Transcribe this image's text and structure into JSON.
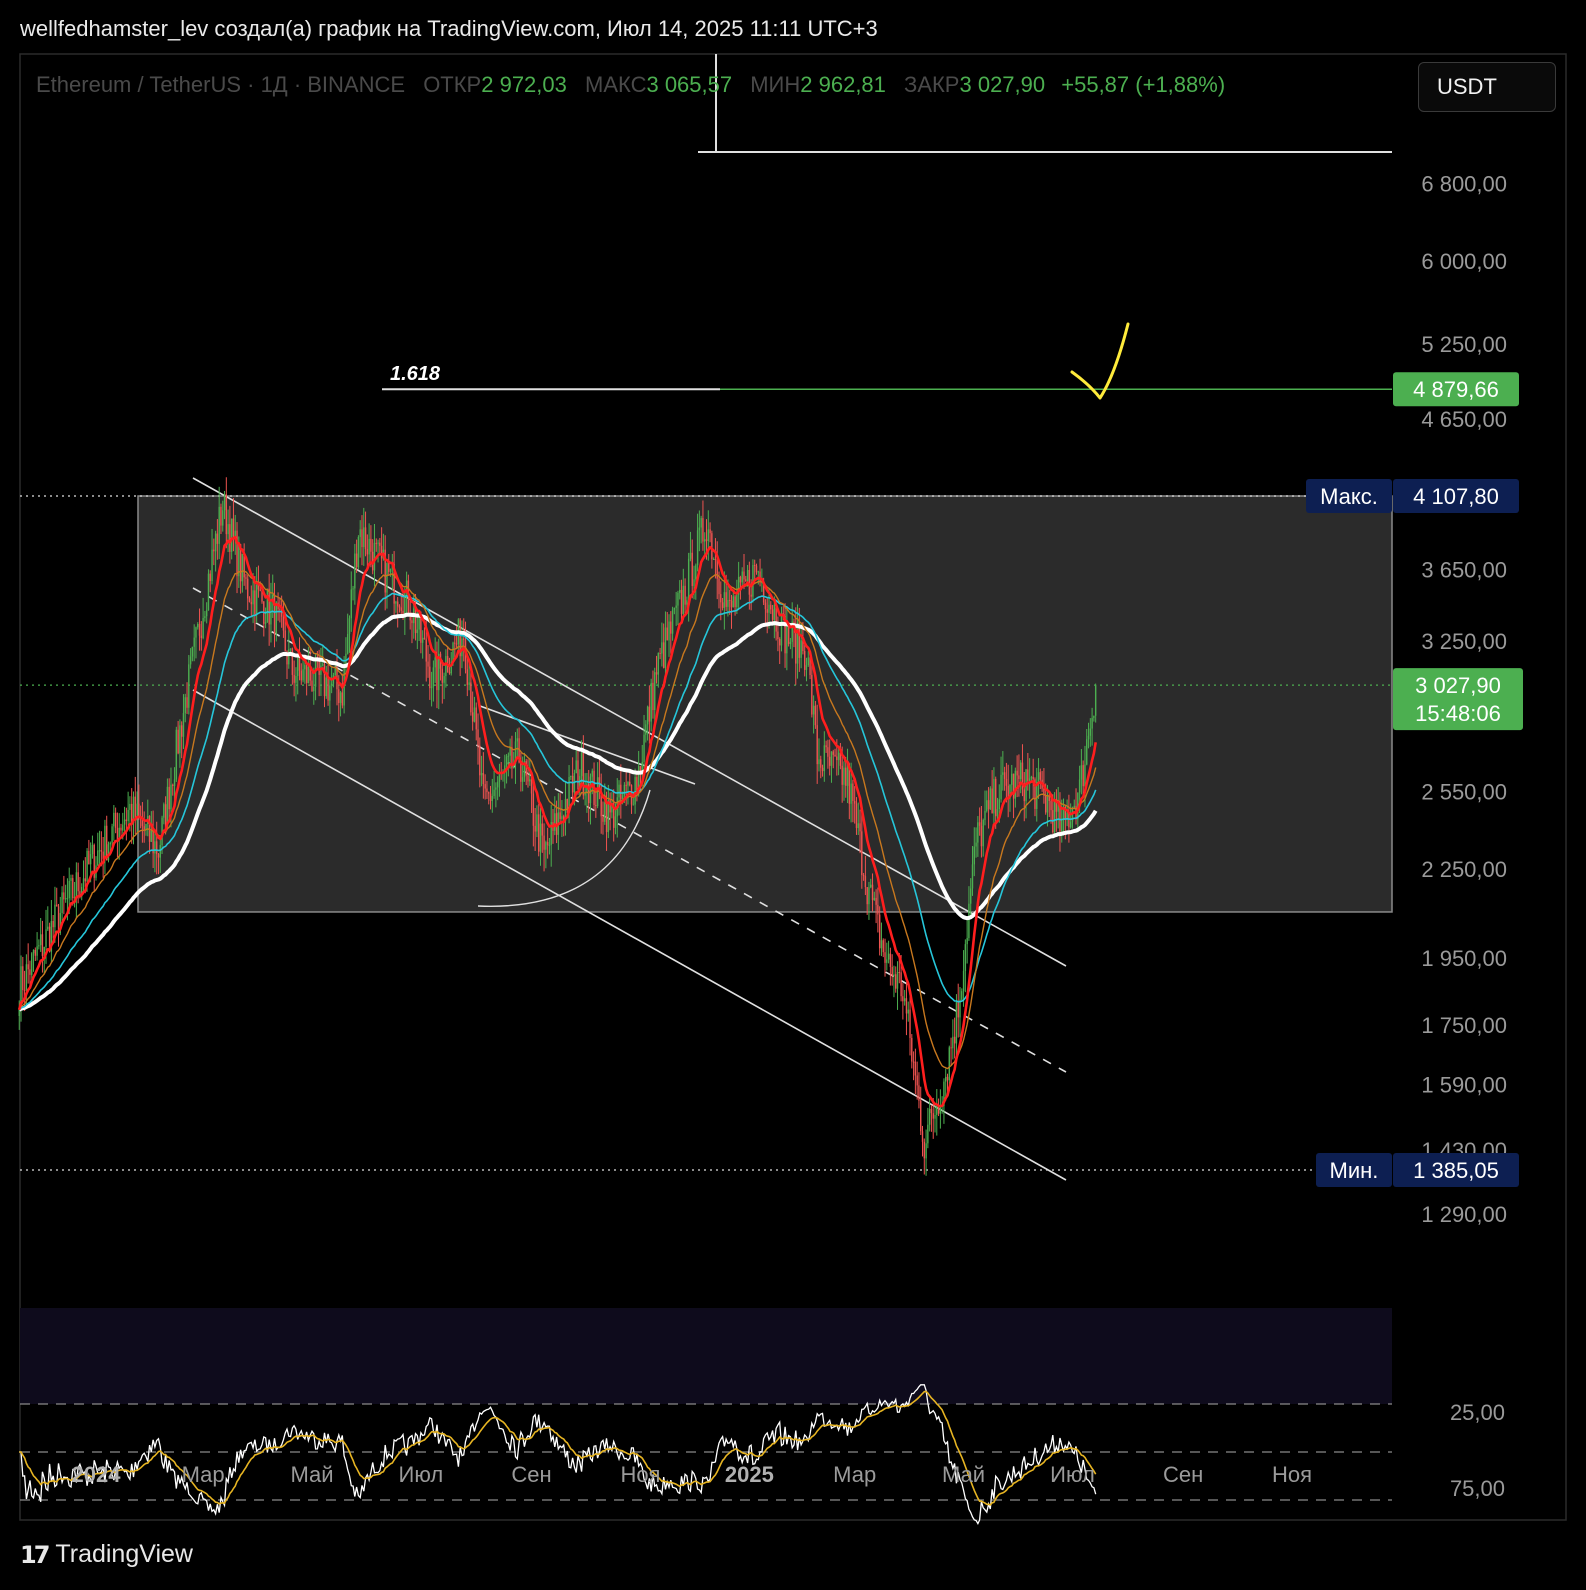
{
  "header": {
    "attribution": "wellfedhamster_lev создал(а) график на TradingView.com, Июл 14, 2025 11:11 UTC+3"
  },
  "legend": {
    "symbol": "Ethereum / TetherUS · 1Д · BINANCE",
    "open_label": "ОТКР",
    "open": "2 972,03",
    "high_label": "МАКС",
    "high": "3 065,57",
    "low_label": "МИН",
    "low": "2 962,81",
    "close_label": "ЗАКР",
    "close": "3 027,90",
    "change": "+55,87 (+1,88%)"
  },
  "currency_button": "USDT",
  "footer": {
    "brand": "TradingView",
    "logo": "17"
  },
  "colors": {
    "up": "#4caf50",
    "down": "#ef5350",
    "ema_fast": "#ff1e1e",
    "ema_mid": "#c8781e",
    "ema_slow": "#26c6da",
    "ma_long": "#ffffff",
    "range_box": "#333333",
    "rsi": "#ffffff",
    "rsi_ma": "#e6b422",
    "checkmark": "#ffeb3b"
  },
  "chart_data": {
    "type": "candlestick",
    "symbol": "ETHUSDT",
    "timeframe": "1D",
    "y_scale": "log",
    "y_ticks": [
      "6 800,00",
      "6 000,00",
      "5 250,00",
      "4 650,00",
      "3 650,00",
      "3 250,00",
      "2 550,00",
      "2 250,00",
      "1 950,00",
      "1 750,00",
      "1 590,00",
      "1 430,00",
      "1 290,00"
    ],
    "x_ticks": [
      "2024",
      "Мар",
      "Май",
      "Июл",
      "Сен",
      "Ноя",
      "2025",
      "Мар",
      "Май",
      "Июл",
      "Сен",
      "Ноя"
    ],
    "last_price": {
      "label": "3 027,90",
      "countdown": "15:48:06",
      "value": 3027.9
    },
    "max_marker": {
      "label": "Макс.",
      "value_label": "4 107,80",
      "value": 4107.8
    },
    "min_marker": {
      "label": "Мин.",
      "value_label": "1 385,05",
      "value": 1385.05
    },
    "fib_level": {
      "label": "1.618",
      "value_label": "4 879,66",
      "value": 4879.66
    },
    "rsi": {
      "ticks": [
        "75,00",
        "25,00"
      ],
      "upper": 75,
      "lower": 25,
      "last": 72
    },
    "price_path": [
      {
        "date": "2024-01-01",
        "close": 2300
      },
      {
        "date": "2024-01-20",
        "close": 2480
      },
      {
        "date": "2024-02-05",
        "close": 2320
      },
      {
        "date": "2024-02-20",
        "close": 2950
      },
      {
        "date": "2024-03-05",
        "close": 3650
      },
      {
        "date": "2024-03-12",
        "close": 4050
      },
      {
        "date": "2024-03-25",
        "close": 3550
      },
      {
        "date": "2024-04-10",
        "close": 3400
      },
      {
        "date": "2024-04-20",
        "close": 3100
      },
      {
        "date": "2024-05-05",
        "close": 3050
      },
      {
        "date": "2024-05-18",
        "close": 3000
      },
      {
        "date": "2024-05-27",
        "close": 3900
      },
      {
        "date": "2024-06-10",
        "close": 3650
      },
      {
        "date": "2024-06-25",
        "close": 3450
      },
      {
        "date": "2024-07-08",
        "close": 3050
      },
      {
        "date": "2024-07-25",
        "close": 3300
      },
      {
        "date": "2024-08-05",
        "close": 2500
      },
      {
        "date": "2024-08-25",
        "close": 2700
      },
      {
        "date": "2024-09-08",
        "close": 2300
      },
      {
        "date": "2024-09-28",
        "close": 2650
      },
      {
        "date": "2024-10-15",
        "close": 2450
      },
      {
        "date": "2024-10-30",
        "close": 2600
      },
      {
        "date": "2024-11-10",
        "close": 3100
      },
      {
        "date": "2024-11-25",
        "close": 3500
      },
      {
        "date": "2024-12-08",
        "close": 3950
      },
      {
        "date": "2024-12-20",
        "close": 3400
      },
      {
        "date": "2025-01-05",
        "close": 3650
      },
      {
        "date": "2025-01-20",
        "close": 3300
      },
      {
        "date": "2025-02-02",
        "close": 3200
      },
      {
        "date": "2025-02-08",
        "close": 2700
      },
      {
        "date": "2025-02-25",
        "close": 2600
      },
      {
        "date": "2025-03-08",
        "close": 2200
      },
      {
        "date": "2025-03-18",
        "close": 1950
      },
      {
        "date": "2025-03-28",
        "close": 1850
      },
      {
        "date": "2025-04-09",
        "close": 1450
      },
      {
        "date": "2025-04-20",
        "close": 1600
      },
      {
        "date": "2025-04-28",
        "close": 1800
      },
      {
        "date": "2025-05-08",
        "close": 2350
      },
      {
        "date": "2025-05-20",
        "close": 2550
      },
      {
        "date": "2025-06-05",
        "close": 2600
      },
      {
        "date": "2025-06-18",
        "close": 2500
      },
      {
        "date": "2025-06-25",
        "close": 2400
      },
      {
        "date": "2025-07-05",
        "close": 2550
      },
      {
        "date": "2025-07-14",
        "close": 3027.9
      }
    ]
  }
}
